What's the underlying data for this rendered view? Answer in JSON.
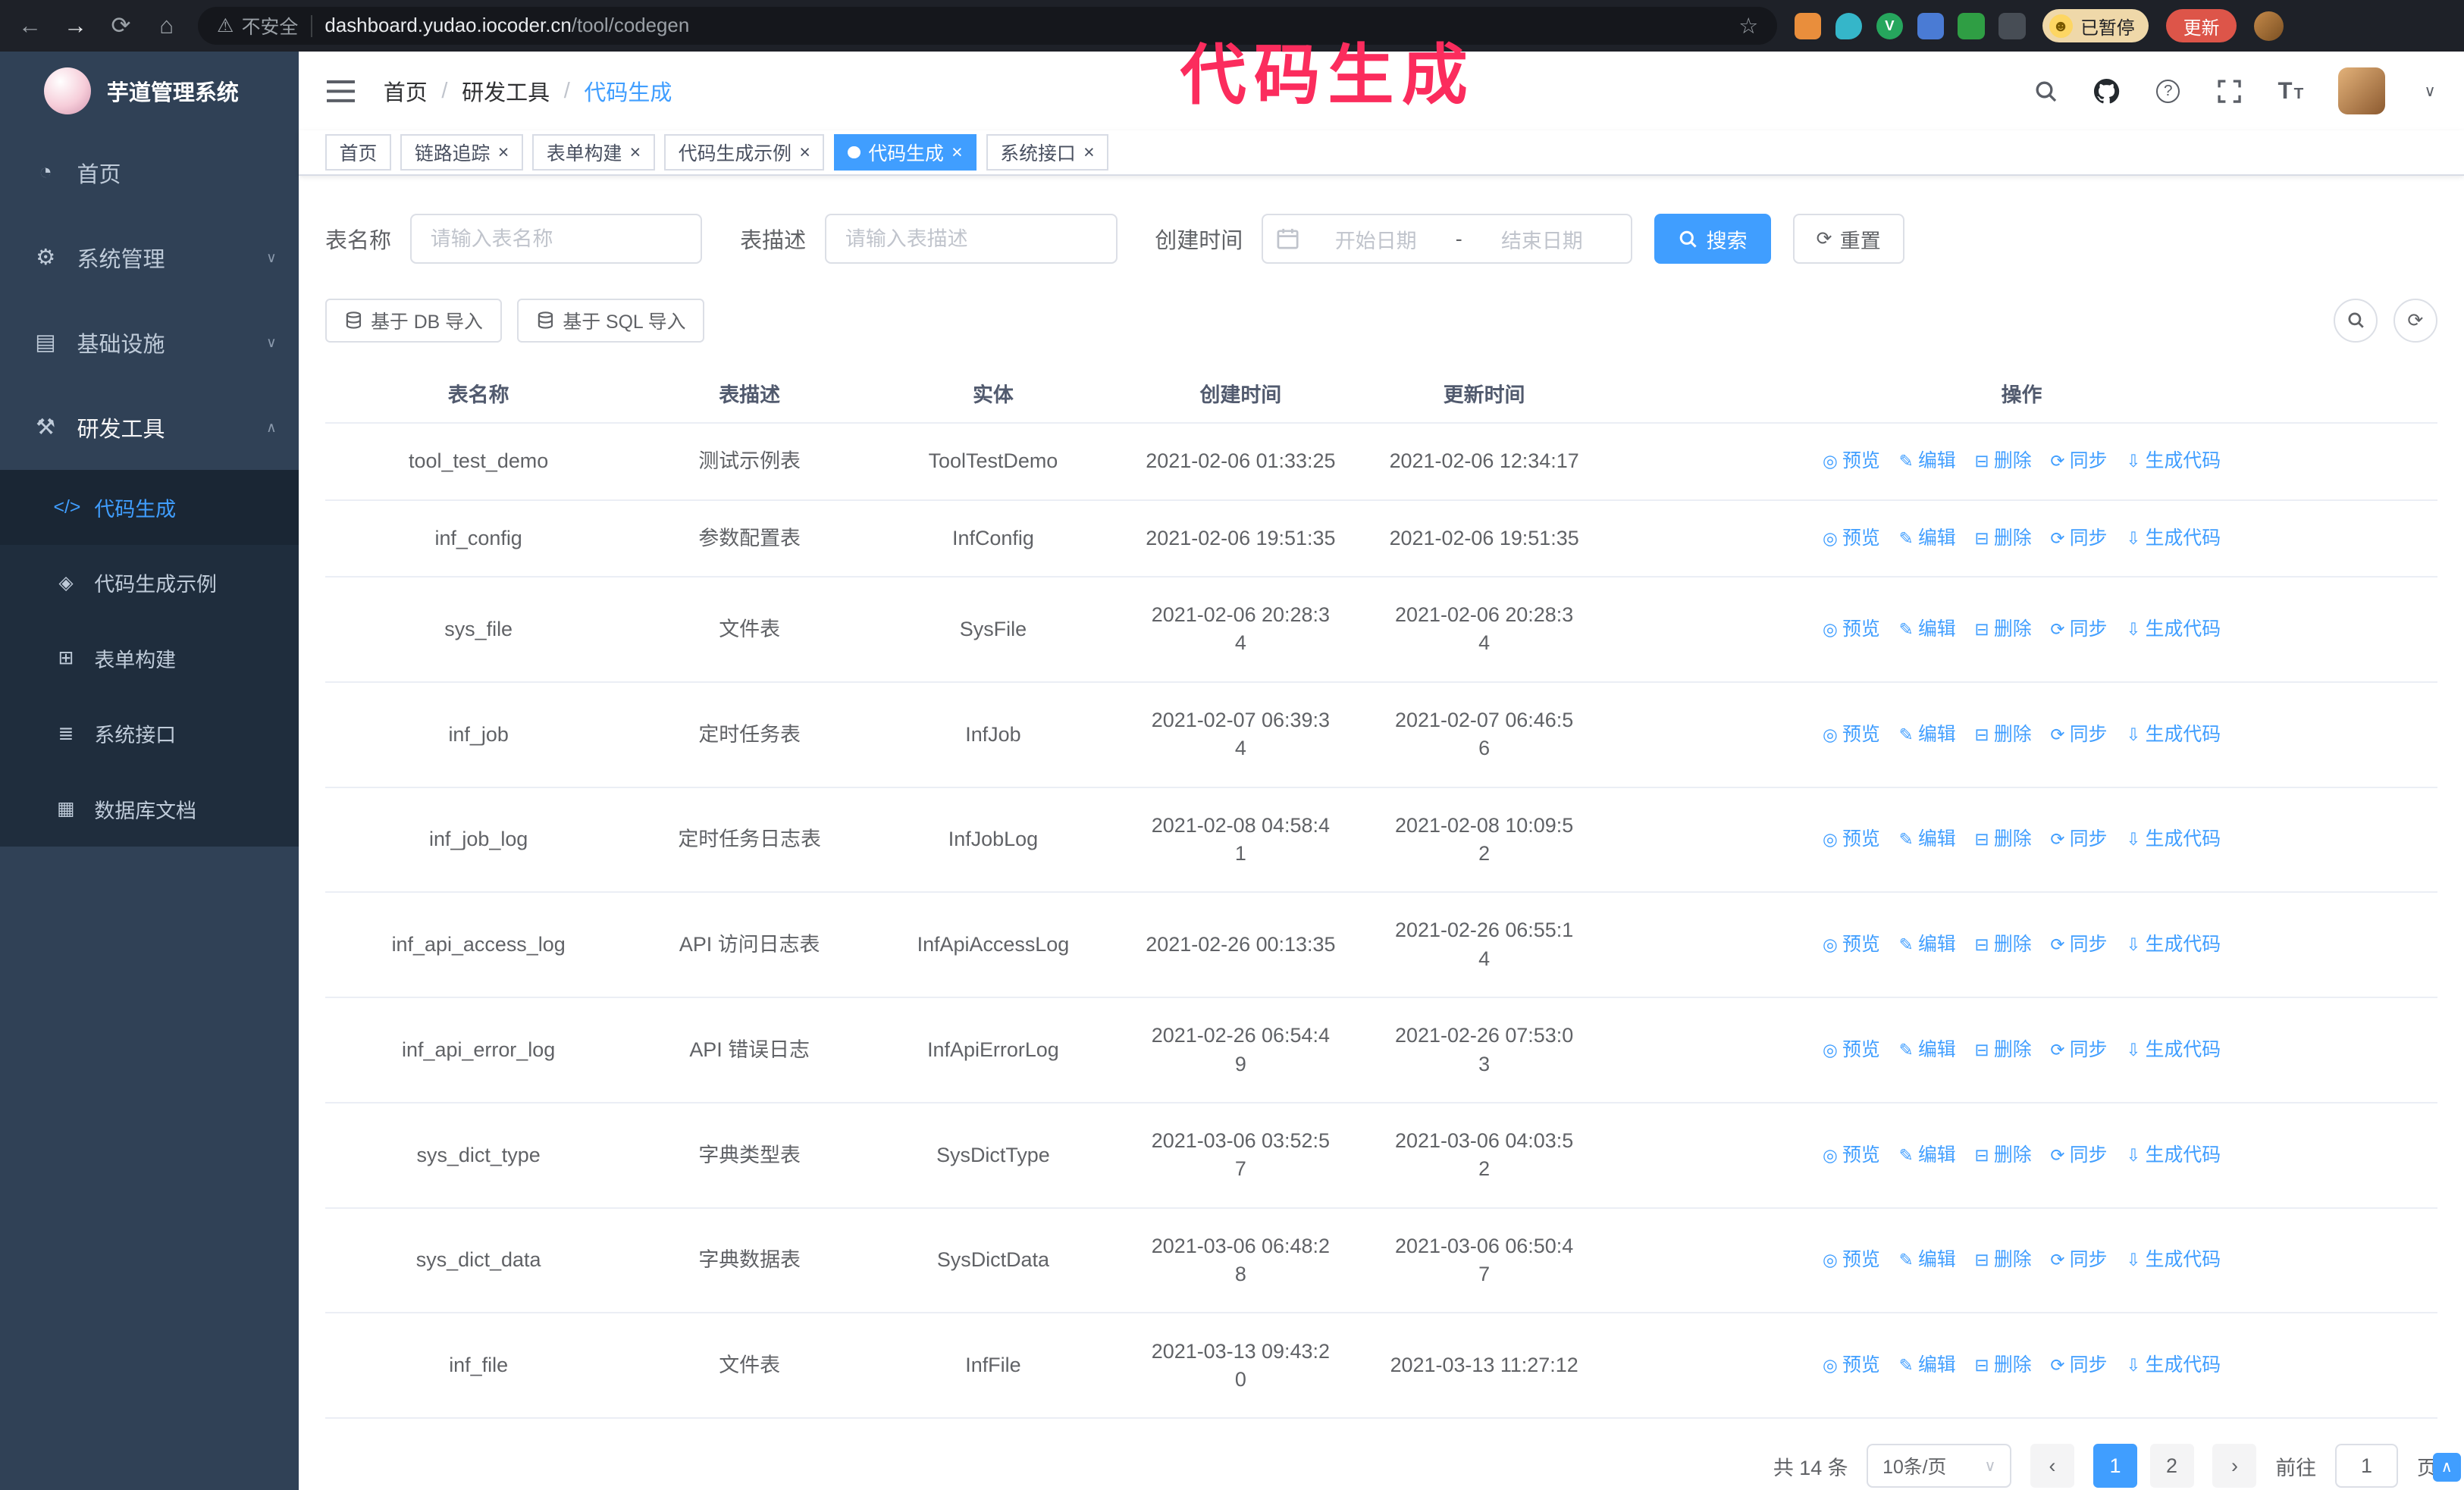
{
  "colors": {
    "accent": "#409eff",
    "sidebar_bg": "#304156",
    "annotation": "#fb2c5d",
    "update_button_bg": "#dd5549"
  },
  "annotation": {
    "text": "代码生成"
  },
  "browser": {
    "security_warning": "不安全",
    "url_host": "dashboard.yudao.iocoder.cn",
    "url_path": "/tool/codegen",
    "paused_badge": "已暂停",
    "update_button": "更新"
  },
  "sidebar": {
    "logo_title": "芋道管理系统",
    "items": [
      {
        "label": "首页",
        "icon": "home"
      },
      {
        "label": "系统管理",
        "icon": "gear",
        "chevron": "down"
      },
      {
        "label": "基础设施",
        "icon": "infra",
        "chevron": "down"
      },
      {
        "label": "研发工具",
        "icon": "tools",
        "chevron": "up",
        "expanded": true
      }
    ],
    "subitems": [
      {
        "label": "代码生成",
        "icon": "code",
        "active": true
      },
      {
        "label": "代码生成示例",
        "icon": "sample"
      },
      {
        "label": "表单构建",
        "icon": "form"
      },
      {
        "label": "系统接口",
        "icon": "api"
      },
      {
        "label": "数据库文档",
        "icon": "db"
      }
    ]
  },
  "header": {
    "breadcrumb": [
      "首页",
      "研发工具",
      "代码生成"
    ],
    "separator": "/"
  },
  "tabs": [
    {
      "label": "首页",
      "closable": false
    },
    {
      "label": "链路追踪",
      "closable": true
    },
    {
      "label": "表单构建",
      "closable": true
    },
    {
      "label": "代码生成示例",
      "closable": true
    },
    {
      "label": "代码生成",
      "closable": true,
      "active": true
    },
    {
      "label": "系统接口",
      "closable": true
    }
  ],
  "filters": {
    "table_name_label": "表名称",
    "table_name_placeholder": "请输入表名称",
    "table_desc_label": "表描述",
    "table_desc_placeholder": "请输入表描述",
    "create_time_label": "创建时间",
    "start_placeholder": "开始日期",
    "range_separator": "-",
    "end_placeholder": "结束日期",
    "search_button": "搜索",
    "reset_button": "重置"
  },
  "toolbar": {
    "import_db": "基于 DB 导入",
    "import_sql": "基于 SQL 导入"
  },
  "table": {
    "columns": [
      "表名称",
      "表描述",
      "实体",
      "创建时间",
      "更新时间",
      "操作"
    ],
    "actions": [
      {
        "label": "预览",
        "icon": "eye"
      },
      {
        "label": "编辑",
        "icon": "edit"
      },
      {
        "label": "删除",
        "icon": "trash"
      },
      {
        "label": "同步",
        "icon": "sync"
      },
      {
        "label": "生成代码",
        "icon": "download"
      }
    ],
    "rows": [
      {
        "name": "tool_test_demo",
        "desc": "测试示例表",
        "entity": "ToolTestDemo",
        "created": "2021-02-06 01:33:25",
        "updated": "2021-02-06 12:34:17"
      },
      {
        "name": "inf_config",
        "desc": "参数配置表",
        "entity": "InfConfig",
        "created": "2021-02-06 19:51:35",
        "updated": "2021-02-06 19:51:35"
      },
      {
        "name": "sys_file",
        "desc": "文件表",
        "entity": "SysFile",
        "created": "2021-02-06 20:28:3\n4",
        "updated": "2021-02-06 20:28:3\n4"
      },
      {
        "name": "inf_job",
        "desc": "定时任务表",
        "entity": "InfJob",
        "created": "2021-02-07 06:39:3\n4",
        "updated": "2021-02-07 06:46:5\n6"
      },
      {
        "name": "inf_job_log",
        "desc": "定时任务日志表",
        "entity": "InfJobLog",
        "created": "2021-02-08 04:58:4\n1",
        "updated": "2021-02-08 10:09:5\n2"
      },
      {
        "name": "inf_api_access_log",
        "desc": "API 访问日志表",
        "entity": "InfApiAccessLog",
        "created": "2021-02-26 00:13:35",
        "updated": "2021-02-26 06:55:1\n4"
      },
      {
        "name": "inf_api_error_log",
        "desc": "API 错误日志",
        "entity": "InfApiErrorLog",
        "created": "2021-02-26 06:54:4\n9",
        "updated": "2021-02-26 07:53:0\n3"
      },
      {
        "name": "sys_dict_type",
        "desc": "字典类型表",
        "entity": "SysDictType",
        "created": "2021-03-06 03:52:5\n7",
        "updated": "2021-03-06 04:03:5\n2"
      },
      {
        "name": "sys_dict_data",
        "desc": "字典数据表",
        "entity": "SysDictData",
        "created": "2021-03-06 06:48:2\n8",
        "updated": "2021-03-06 06:50:4\n7"
      },
      {
        "name": "inf_file",
        "desc": "文件表",
        "entity": "InfFile",
        "created": "2021-03-13 09:43:2\n0",
        "updated": "2021-03-13 11:27:12"
      }
    ]
  },
  "pagination": {
    "total": "共 14 条",
    "page_size": "10条/页",
    "pages": [
      "1",
      "2"
    ],
    "active_page": "1",
    "goto_label": "前往",
    "goto_value": "1",
    "page_unit": "页"
  }
}
